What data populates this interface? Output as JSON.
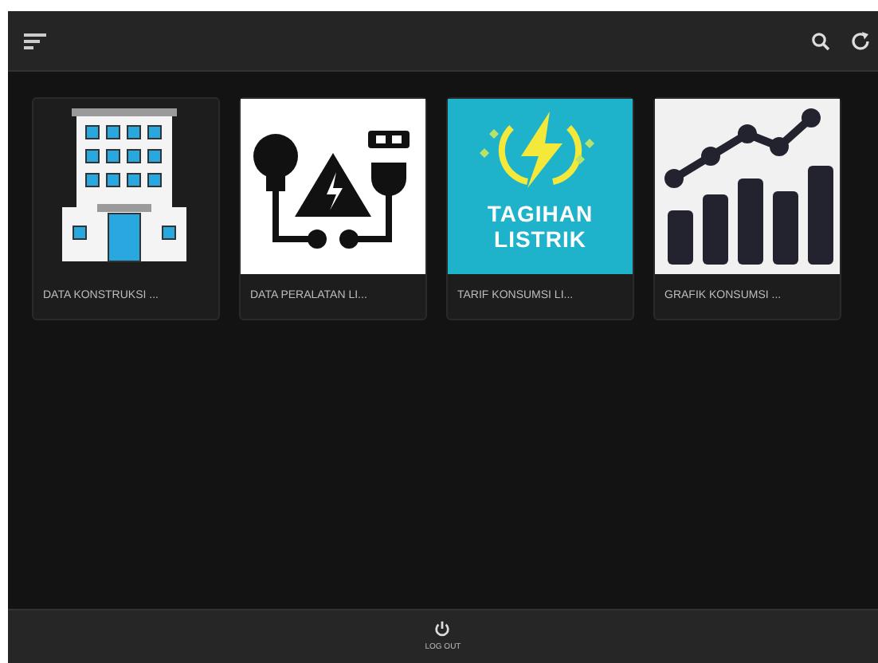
{
  "cards": [
    {
      "kind": "building",
      "caption": "DATA KONSTRUKSI ..."
    },
    {
      "kind": "equipment",
      "caption": "DATA PERALATAN LI..."
    },
    {
      "kind": "bill",
      "caption": "TARIF KONSUMSI LI...",
      "banner": [
        "TAGIHAN",
        "LISTRIK"
      ]
    },
    {
      "kind": "graph",
      "caption": "GRAFIK KONSUMSI ..."
    }
  ],
  "footer": {
    "button": "LOG OUT"
  }
}
